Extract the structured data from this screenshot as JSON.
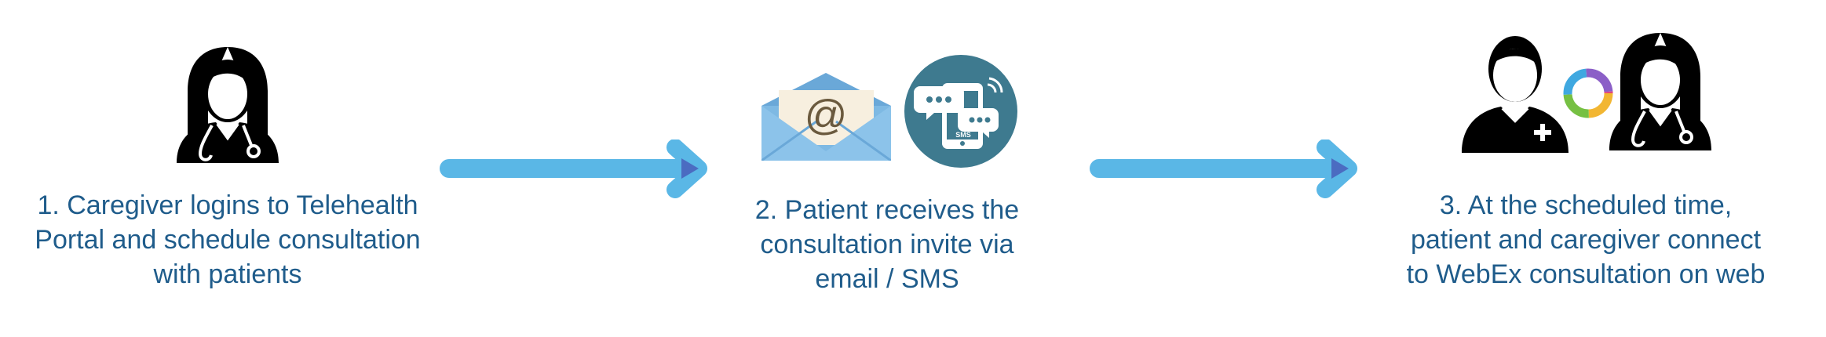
{
  "steps": [
    {
      "lines": [
        "1. Caregiver logins to Telehealth",
        "Portal and schedule consultation",
        "with patients"
      ],
      "icon": "doctor-icon"
    },
    {
      "lines": [
        "2. Patient receives the",
        "consultation invite via",
        "email / SMS"
      ],
      "icons": [
        "email-envelope-icon",
        "sms-phone-icon"
      ],
      "email_symbol": "@",
      "sms_badge": "SMS"
    },
    {
      "lines": [
        "3. At the scheduled time,",
        "patient and caregiver connect",
        "to WebEx consultation on web"
      ],
      "icons": [
        "patient-icon",
        "webex-icon",
        "doctor-icon"
      ]
    }
  ],
  "colors": {
    "text": "#1f5c8b",
    "arrow": "#5ab7e6",
    "arrow_head": "#4b6cc1",
    "sms_circle": "#3e7a8f",
    "envelope": "#7eb9e3"
  }
}
